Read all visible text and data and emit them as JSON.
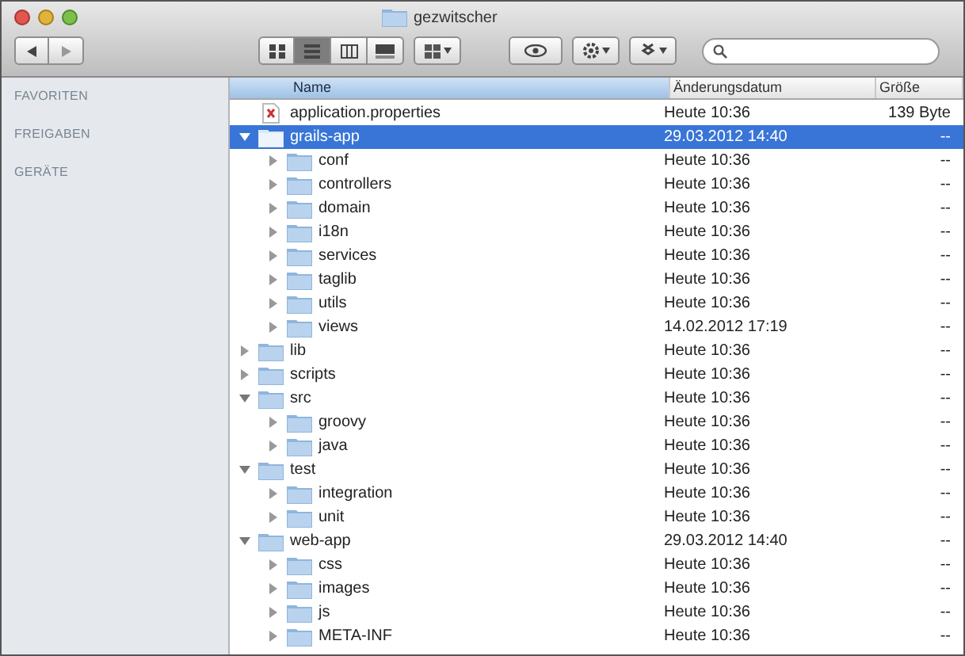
{
  "window": {
    "title": "gezwitscher"
  },
  "toolbar": {
    "view_buttons": [
      {
        "selected": false
      },
      {
        "selected": true
      },
      {
        "selected": false
      },
      {
        "selected": false
      }
    ]
  },
  "sidebar": {
    "sections": [
      "FAVORITEN",
      "FREIGABEN",
      "GERÄTE"
    ]
  },
  "table": {
    "columns": [
      {
        "label": "Name",
        "sorted": true
      },
      {
        "label": "Änderungsdatum",
        "sorted": false
      },
      {
        "label": "Größe",
        "sorted": false
      }
    ],
    "rows": [
      {
        "kind": "file",
        "name": "application.properties",
        "date": "Heute 10:36",
        "size": "139 Byte",
        "selected": false
      },
      {
        "kind": "folder",
        "name": "grails-app",
        "date": "29.03.2012 14:40",
        "size": "--",
        "selected": true,
        "expanded": true,
        "children": [
          {
            "kind": "folder",
            "name": "conf",
            "date": "Heute 10:36",
            "size": "--",
            "selected": false,
            "expanded": false
          },
          {
            "kind": "folder",
            "name": "controllers",
            "date": "Heute 10:36",
            "size": "--",
            "selected": false,
            "expanded": false
          },
          {
            "kind": "folder",
            "name": "domain",
            "date": "Heute 10:36",
            "size": "--",
            "selected": false,
            "expanded": false
          },
          {
            "kind": "folder",
            "name": "i18n",
            "date": "Heute 10:36",
            "size": "--",
            "selected": false,
            "expanded": false
          },
          {
            "kind": "folder",
            "name": "services",
            "date": "Heute 10:36",
            "size": "--",
            "selected": false,
            "expanded": false
          },
          {
            "kind": "folder",
            "name": "taglib",
            "date": "Heute 10:36",
            "size": "--",
            "selected": false,
            "expanded": false
          },
          {
            "kind": "folder",
            "name": "utils",
            "date": "Heute 10:36",
            "size": "--",
            "selected": false,
            "expanded": false
          },
          {
            "kind": "folder",
            "name": "views",
            "date": "14.02.2012 17:19",
            "size": "--",
            "selected": false,
            "expanded": false
          }
        ]
      },
      {
        "kind": "folder",
        "name": "lib",
        "date": "Heute 10:36",
        "size": "--",
        "selected": false,
        "expanded": false
      },
      {
        "kind": "folder",
        "name": "scripts",
        "date": "Heute 10:36",
        "size": "--",
        "selected": false,
        "expanded": false
      },
      {
        "kind": "folder",
        "name": "src",
        "date": "Heute 10:36",
        "size": "--",
        "selected": false,
        "expanded": true,
        "children": [
          {
            "kind": "folder",
            "name": "groovy",
            "date": "Heute 10:36",
            "size": "--",
            "selected": false,
            "expanded": false
          },
          {
            "kind": "folder",
            "name": "java",
            "date": "Heute 10:36",
            "size": "--",
            "selected": false,
            "expanded": false
          }
        ]
      },
      {
        "kind": "folder",
        "name": "test",
        "date": "Heute 10:36",
        "size": "--",
        "selected": false,
        "expanded": true,
        "children": [
          {
            "kind": "folder",
            "name": "integration",
            "date": "Heute 10:36",
            "size": "--",
            "selected": false,
            "expanded": false
          },
          {
            "kind": "folder",
            "name": "unit",
            "date": "Heute 10:36",
            "size": "--",
            "selected": false,
            "expanded": false
          }
        ]
      },
      {
        "kind": "folder",
        "name": "web-app",
        "date": "29.03.2012 14:40",
        "size": "--",
        "selected": false,
        "expanded": true,
        "children": [
          {
            "kind": "folder",
            "name": "css",
            "date": "Heute 10:36",
            "size": "--",
            "selected": false,
            "expanded": false
          },
          {
            "kind": "folder",
            "name": "images",
            "date": "Heute 10:36",
            "size": "--",
            "selected": false,
            "expanded": false
          },
          {
            "kind": "folder",
            "name": "js",
            "date": "Heute 10:36",
            "size": "--",
            "selected": false,
            "expanded": false
          },
          {
            "kind": "folder",
            "name": "META-INF",
            "date": "Heute 10:36",
            "size": "--",
            "selected": false,
            "expanded": false
          }
        ]
      }
    ]
  }
}
